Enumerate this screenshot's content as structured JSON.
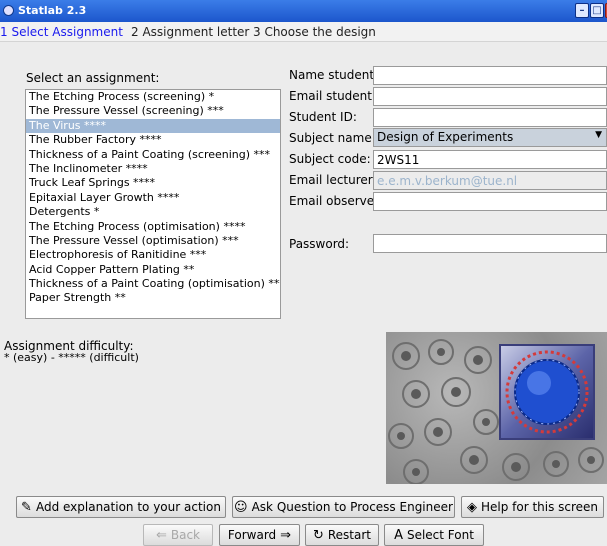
{
  "window": {
    "title": "Statlab 2.3"
  },
  "tabs": [
    {
      "label": "1 Select Assignment",
      "active": true
    },
    {
      "label": "2 Assignment letter",
      "active": false
    },
    {
      "label": "3 Choose the design",
      "active": false
    }
  ],
  "assignments": {
    "label": "Select an assignment:",
    "selected_index": 2,
    "items": [
      "The Etching Process (screening) *",
      "The Pressure Vessel (screening) ***",
      "The Virus ****",
      "The Rubber Factory ****",
      "Thickness of a Paint Coating (screening) ***",
      "The Inclinometer ****",
      "Truck Leaf Springs ****",
      "Epitaxial Layer Growth ****",
      "Detergents *",
      "The Etching Process (optimisation) ****",
      "The Pressure Vessel (optimisation) ***",
      "Electrophoresis of Ranitidine ***",
      "Acid Copper Pattern Plating **",
      "Thickness of a Paint Coating (optimisation) ***",
      "Paper Strength **"
    ]
  },
  "form": {
    "name_student": {
      "label": "Name student:",
      "value": ""
    },
    "email_student": {
      "label": "Email student:",
      "value": ""
    },
    "student_id": {
      "label": "Student ID:",
      "value": ""
    },
    "subject_name": {
      "label": "Subject name:",
      "value": "Design of Experiments"
    },
    "subject_code": {
      "label": "Subject code:",
      "value": "2WS11"
    },
    "email_lecturer": {
      "label": "Email lecturer:",
      "value": "e.e.m.v.berkum@tue.nl"
    },
    "email_observer": {
      "label": "Email observer:",
      "value": ""
    },
    "password": {
      "label": "Password:",
      "value": ""
    }
  },
  "difficulty": {
    "heading": "Assignment difficulty:",
    "scale": "* (easy) - ***** (difficult)"
  },
  "actions": {
    "add_explanation": "Add explanation to your action",
    "ask_question": "Ask Question to Process Engineer",
    "help": "Help for this screen"
  },
  "nav": {
    "back": "Back",
    "forward": "Forward",
    "restart": "Restart",
    "select_font": "Select Font"
  },
  "colors": {
    "title_bar": "#1c56cc",
    "active_tab": "#1a1aee",
    "list_selection": "#9fb8d6",
    "disabled_text": "#9cb4cc"
  }
}
